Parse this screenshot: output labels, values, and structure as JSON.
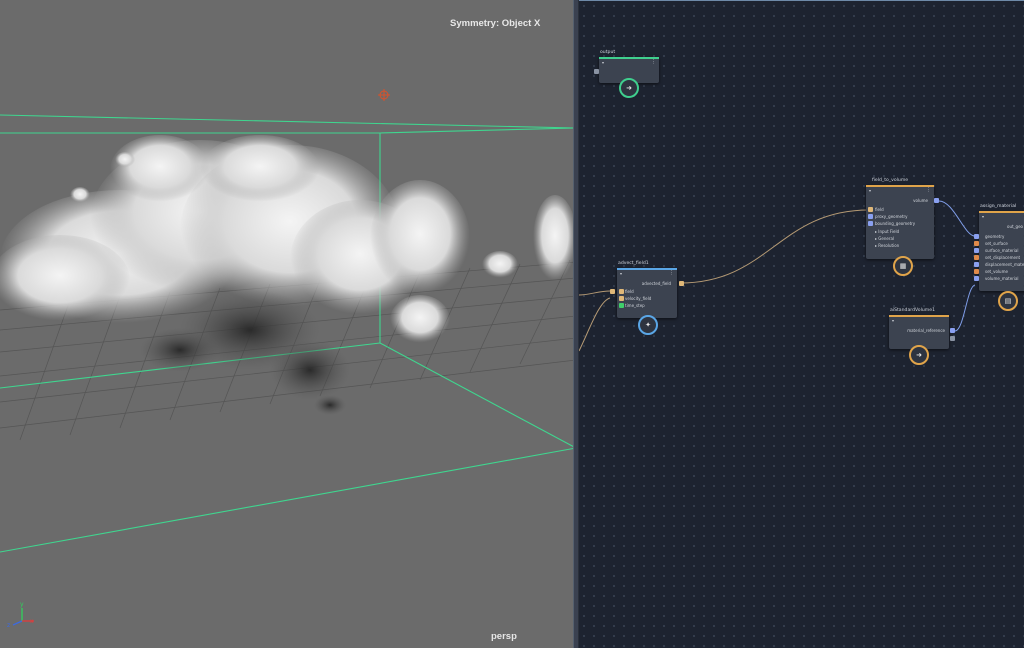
{
  "viewport": {
    "symmetry_label": "Symmetry: Object X",
    "camera_label": "persp",
    "axis_y": "y",
    "axis_x": "x",
    "axis_z": "z"
  },
  "graph": {
    "nodes": {
      "output": {
        "title": "output",
        "badge_icon": "arrow-right-icon"
      },
      "field_to_volume": {
        "title": "field_to_volume",
        "out_port": "volume",
        "in_ports": [
          "field",
          "proxy_geometry",
          "bounding_geometry"
        ],
        "groups": [
          "Input Field",
          "General",
          "Resolution"
        ]
      },
      "assign_material": {
        "title": "assign_material",
        "out_port": "out_geo",
        "in_ports": [
          "geometry",
          "set_surface",
          "surface_material",
          "set_displacement",
          "displacement_mate",
          "set_volume",
          "volume_material"
        ]
      },
      "advect_field": {
        "title": "advect_field1",
        "out_port": "advected_field",
        "in_ports": [
          "field",
          "velocity_field",
          "time_step"
        ]
      },
      "standard_volume": {
        "title": "aiStandardVolume1",
        "out_port": "material_reference"
      }
    },
    "colors": {
      "green_bar": "#3fcf8e",
      "orange_bar": "#e0a44a",
      "blue_bar": "#5aa6e6",
      "wire": "#b59a74",
      "wire_blue": "#7f9de8"
    }
  }
}
